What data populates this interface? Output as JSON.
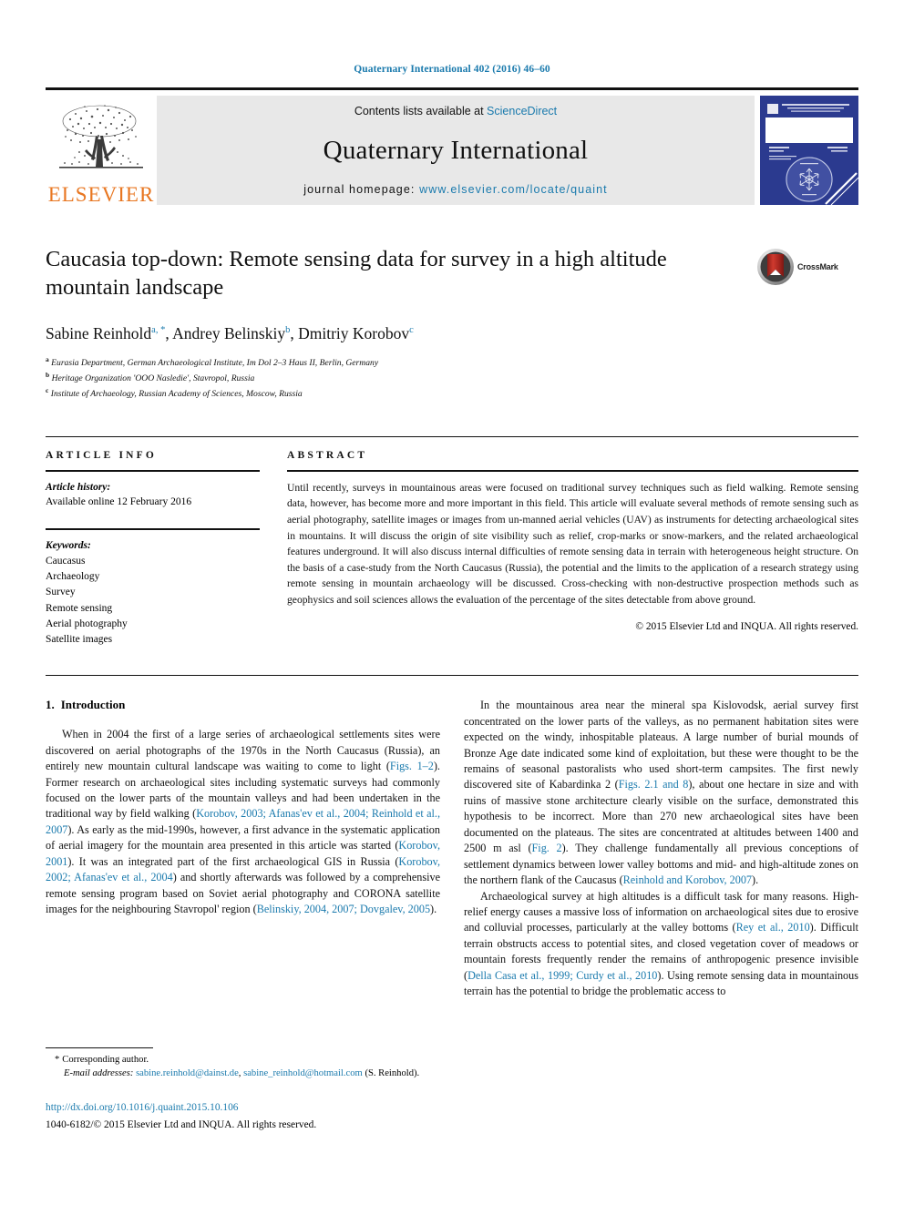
{
  "running_head": "Quaternary International 402 (2016) 46–60",
  "masthead": {
    "publisher": "ELSEVIER",
    "contents_prefix": "Contents lists available at ",
    "contents_link": "ScienceDirect",
    "journal_title": "Quaternary International",
    "homepage_prefix": "journal homepage: ",
    "homepage_url": "www.elsevier.com/locate/quaint",
    "cover_title": "QUATERNARY INTERNATIONAL"
  },
  "article": {
    "title": "Caucasia top-down: Remote sensing data for survey in a high altitude mountain landscape",
    "crossmark_label": "CrossMark",
    "authors": [
      {
        "name": "Sabine Reinhold",
        "marks": "a, *"
      },
      {
        "name": "Andrey Belinskiy",
        "marks": "b"
      },
      {
        "name": "Dmitriy Korobov",
        "marks": "c"
      }
    ],
    "affiliations": [
      {
        "mark": "a",
        "text": "Eurasia Department, German Archaeological Institute, Im Dol 2–3 Haus II, Berlin, Germany"
      },
      {
        "mark": "b",
        "text": "Heritage Organization 'OOO Nasledie', Stavropol, Russia"
      },
      {
        "mark": "c",
        "text": "Institute of Archaeology, Russian Academy of Sciences, Moscow, Russia"
      }
    ]
  },
  "article_info": {
    "heading": "ARTICLE INFO",
    "history_label": "Article history:",
    "history_value": "Available online 12 February 2016",
    "keywords_label": "Keywords:",
    "keywords": [
      "Caucasus",
      "Archaeology",
      "Survey",
      "Remote sensing",
      "Aerial photography",
      "Satellite images"
    ]
  },
  "abstract": {
    "heading": "ABSTRACT",
    "text": "Until recently, surveys in mountainous areas were focused on traditional survey techniques such as field walking. Remote sensing data, however, has become more and more important in this field. This article will evaluate several methods of remote sensing such as aerial photography, satellite images or images from un-manned aerial vehicles (UAV) as instruments for detecting archaeological sites in mountains. It will discuss the origin of site visibility such as relief, crop-marks or snow-markers, and the related archaeological features underground. It will also discuss internal difficulties of remote sensing data in terrain with heterogeneous height structure. On the basis of a case-study from the North Caucasus (Russia), the potential and the limits to the application of a research strategy using remote sensing in mountain archaeology will be discussed. Cross-checking with non-destructive prospection methods such as geophysics and soil sciences allows the evaluation of the percentage of the sites detectable from above ground.",
    "copyright": "© 2015 Elsevier Ltd and INQUA. All rights reserved."
  },
  "body": {
    "section_number": "1.",
    "section_title": "Introduction",
    "left_paragraphs": [
      {
        "segments": [
          {
            "t": "When in 2004 the first of a large series of archaeological settlements sites were discovered on aerial photographs of the 1970s in the North Caucasus (Russia), an entirely new mountain cultural landscape was waiting to come to light ("
          },
          {
            "t": "Figs. 1–2",
            "link": true
          },
          {
            "t": "). Former research on archaeological sites including systematic surveys had commonly focused on the lower parts of the mountain valleys and had been undertaken in the traditional way by field walking ("
          },
          {
            "t": "Korobov, 2003; Afanas'ev et al., 2004; Reinhold et al., 2007",
            "link": true
          },
          {
            "t": "). As early as the mid-1990s, however, a first advance in the systematic application of aerial imagery for the mountain area presented in this article was started ("
          },
          {
            "t": "Korobov, 2001",
            "link": true
          },
          {
            "t": "). It was an integrated part of the first archaeological GIS in Russia ("
          },
          {
            "t": "Korobov, 2002; Afanas'ev et al., 2004",
            "link": true
          },
          {
            "t": ") and shortly afterwards was followed by a comprehensive remote sensing program based on Soviet aerial photography and CORONA satellite images for the neighbouring Stavropol' region ("
          },
          {
            "t": "Belinskiy, 2004, 2007; Dovgalev, 2005",
            "link": true
          },
          {
            "t": ")."
          }
        ]
      }
    ],
    "right_paragraphs": [
      {
        "segments": [
          {
            "t": "In the mountainous area near the mineral spa Kislovodsk, aerial survey first concentrated on the lower parts of the valleys, as no permanent habitation sites were expected on the windy, inhospitable plateaus. A large number of burial mounds of Bronze Age date indicated some kind of exploitation, but these were thought to be the remains of seasonal pastoralists who used short-term campsites. The first newly discovered site of Kabardinka 2 ("
          },
          {
            "t": "Figs. 2.1 and 8",
            "link": true
          },
          {
            "t": "), about one hectare in size and with ruins of massive stone architecture clearly visible on the surface, demonstrated this hypothesis to be incorrect. More than 270 new archaeological sites have been documented on the plateaus. The sites are concentrated at altitudes between 1400 and 2500 m asl ("
          },
          {
            "t": "Fig. 2",
            "link": true
          },
          {
            "t": "). They challenge fundamentally all previous conceptions of settlement dynamics between lower valley bottoms and mid- and high-altitude zones on the northern flank of the Caucasus ("
          },
          {
            "t": "Reinhold and Korobov, 2007",
            "link": true
          },
          {
            "t": ")."
          }
        ]
      },
      {
        "segments": [
          {
            "t": "Archaeological survey at high altitudes is a difficult task for many reasons. High-relief energy causes a massive loss of information on archaeological sites due to erosive and colluvial processes, particularly at the valley bottoms ("
          },
          {
            "t": "Rey et al., 2010",
            "link": true
          },
          {
            "t": "). Difficult terrain obstructs access to potential sites, and closed vegetation cover of meadows or mountain forests frequently render the remains of anthropogenic presence invisible ("
          },
          {
            "t": "Della Casa et al., 1999; Curdy et al., 2010",
            "link": true
          },
          {
            "t": "). Using remote sensing data in mountainous terrain has the potential to bridge the problematic access to"
          }
        ]
      }
    ]
  },
  "footnotes": {
    "corresponding_star": "*",
    "corresponding_text": "Corresponding author.",
    "email_label": "E-mail addresses:",
    "emails": [
      "sabine.reinhold@dainst.de",
      "sabine_reinhold@hotmail.com"
    ],
    "email_owner": "(S. Reinhold).",
    "doi": "http://dx.doi.org/10.1016/j.quaint.2015.10.106",
    "issn_line": "1040-6182/© 2015 Elsevier Ltd and INQUA. All rights reserved."
  },
  "colors": {
    "link": "#1a7aad",
    "elsevier_orange": "#E87722",
    "cover_blue": "#2b3a8f",
    "crossmark_red": "#c1322c"
  }
}
